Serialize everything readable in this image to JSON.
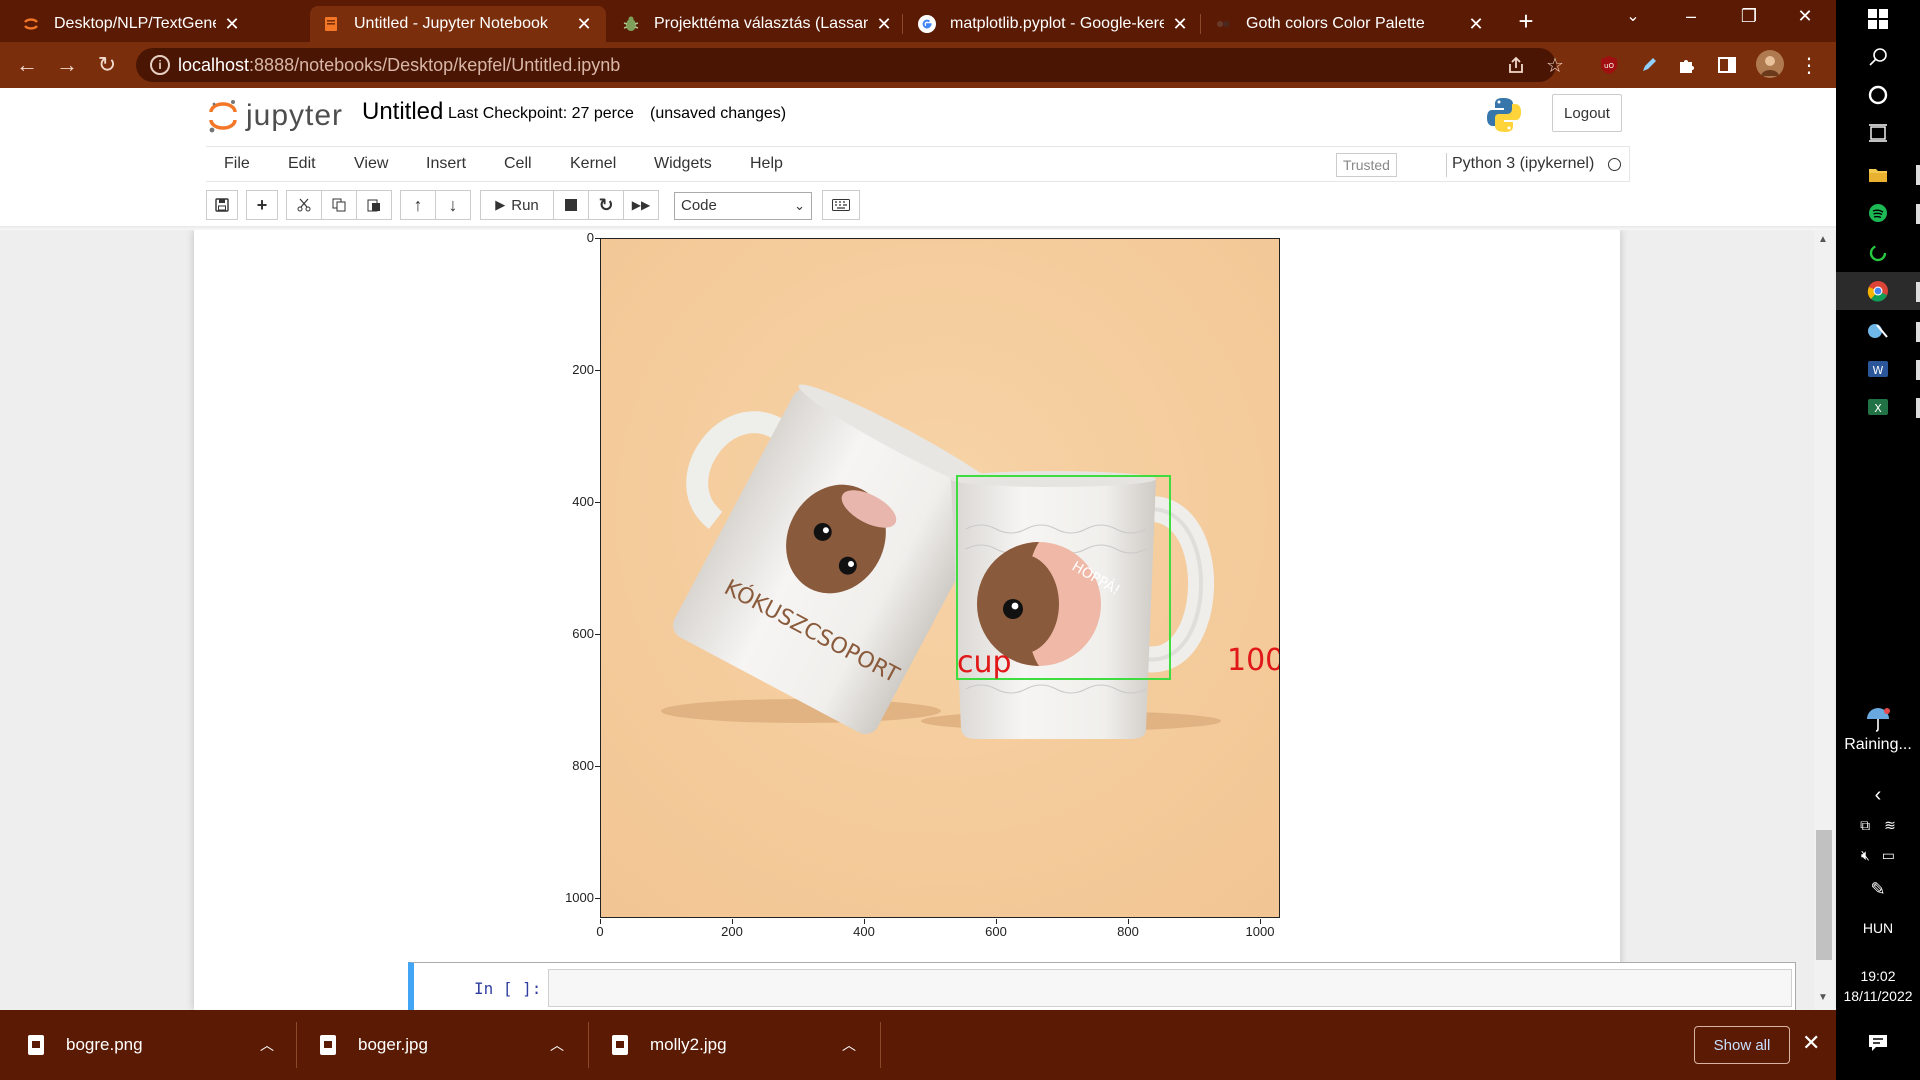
{
  "browser": {
    "tabs": [
      {
        "title": "Desktop/NLP/TextGeneration/",
        "favicon": "jupyter-favicon-icon"
      },
      {
        "title": "Untitled - Jupyter Notebook",
        "favicon": "jupyter-notebook-favicon-icon"
      },
      {
        "title": "Projekttéma választás (Lassan ne",
        "favicon": "bug-favicon-icon"
      },
      {
        "title": "matplotlib.pyplot - Google-keres",
        "favicon": "google-favicon-icon"
      },
      {
        "title": "Goth colors Color Palette",
        "favicon": "palette-favicon-icon"
      }
    ],
    "active_tab": 1,
    "url_host": "localhost",
    "url_rest": ":8888/notebooks/Desktop/kepfel/Untitled.ipynb",
    "theme_colors": {
      "tabstrip": "#5a1a04",
      "toolbar": "#7a2e0c"
    }
  },
  "jupyter": {
    "logo_word": "jupyter",
    "notebook_title": "Untitled",
    "checkpoint": "Last Checkpoint: 27 perce",
    "unsaved": "(unsaved changes)",
    "logout_label": "Logout",
    "menu": [
      "File",
      "Edit",
      "View",
      "Insert",
      "Cell",
      "Kernel",
      "Widgets",
      "Help"
    ],
    "trusted_label": "Trusted",
    "kernel_name": "Python 3 (ipykernel)",
    "toolbar": {
      "run_label": "Run",
      "cell_type": "Code",
      "buttons": [
        "save-icon",
        "plus-icon",
        "cut-icon",
        "copy-icon",
        "paste-icon",
        "arrow-up-icon",
        "arrow-down-icon",
        "run-icon",
        "stop-icon",
        "restart-icon",
        "fast-forward-icon",
        "keyboard-icon"
      ]
    }
  },
  "output": {
    "image_kind": "matplotlib imshow of photo with two mugs and detection box",
    "y_ticks": [
      "0",
      "200",
      "400",
      "600",
      "800",
      "1000"
    ],
    "x_ticks": [
      "0",
      "200",
      "400",
      "600",
      "800",
      "1000"
    ],
    "background_color": "#f5cc9c",
    "mug_left_text": "KÓKUSZCSOPORT",
    "mug_right_text": "HOPPÁ!",
    "detection": {
      "label": "cup",
      "score": "100",
      "box_color": "#3edc3e",
      "text_color": "#e01818"
    }
  },
  "input_cell": {
    "prompt": "In [ ]:"
  },
  "downloads": {
    "items": [
      {
        "name": "bogre.png"
      },
      {
        "name": "boger.jpg"
      },
      {
        "name": "molly2.jpg"
      }
    ],
    "show_all_label": "Show all"
  },
  "taskbar": {
    "weather": "Raining...",
    "language": "HUN",
    "time": "19:02",
    "date": "18/11/2022"
  }
}
